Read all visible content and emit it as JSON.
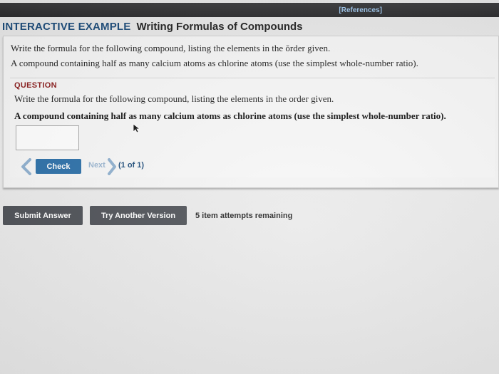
{
  "header": {
    "references_label": "[References]"
  },
  "title": {
    "prefix": "INTERACTIVE EXAMPLE",
    "text": "Writing Formulas of Compounds"
  },
  "intro": {
    "line1": "Write the formula for the following compound, listing the elements in the ŏrder given.",
    "line2": "A compound containing half as many calcium atoms as chlorine atoms (use the simplest whole-number ratio)."
  },
  "question": {
    "label": "QUESTION",
    "text": "Write the formula for the following compound, listing the elements in the order given.",
    "bold_text": "A compound containing half as many calcium atoms as chlorine atoms (use the simplest whole-number ratio).",
    "answer_value": ""
  },
  "nav": {
    "check_label": "Check",
    "next_label": "Next",
    "counter": "(1 of 1)"
  },
  "actions": {
    "submit_label": "Submit Answer",
    "try_another_label": "Try Another Version",
    "attempts_text": "5 item attempts remaining"
  },
  "colors": {
    "accent_blue": "#2b6fa8",
    "title_blue": "#1d4c7a",
    "question_red": "#8b1c1c",
    "dark_button": "#4c4f55"
  }
}
